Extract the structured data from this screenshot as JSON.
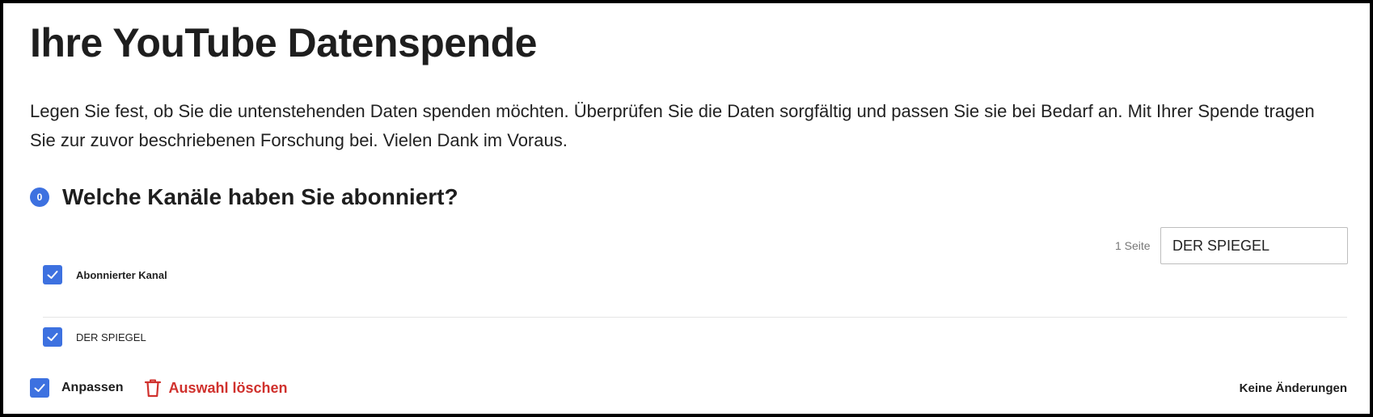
{
  "page": {
    "title": "Ihre YouTube Datenspende",
    "intro": "Legen Sie fest, ob Sie die untenstehenden Daten spenden möchten. Überprüfen Sie die Daten sorgfältig und passen Sie sie bei Bedarf an. Mit Ihrer Spende tragen Sie zur zuvor beschriebenen Forschung bei. Vielen Dank im Voraus."
  },
  "section": {
    "badge": "0",
    "title": "Welche Kanäle haben Sie abonniert?"
  },
  "table": {
    "pager_text": "1 Seite",
    "search_value": "DER SPIEGEL",
    "header": {
      "label": "Abonnierter Kanal",
      "checked": true
    },
    "rows": [
      {
        "label": "DER SPIEGEL",
        "checked": true
      }
    ]
  },
  "footer": {
    "adjust_label": "Anpassen",
    "adjust_checked": true,
    "clear_label": "Auswahl löschen",
    "status_label": "Keine Änderungen"
  },
  "colors": {
    "accent": "#3d71e0",
    "danger": "#d0312d"
  },
  "icons": {
    "check": "check-icon",
    "trash": "trash-icon"
  }
}
